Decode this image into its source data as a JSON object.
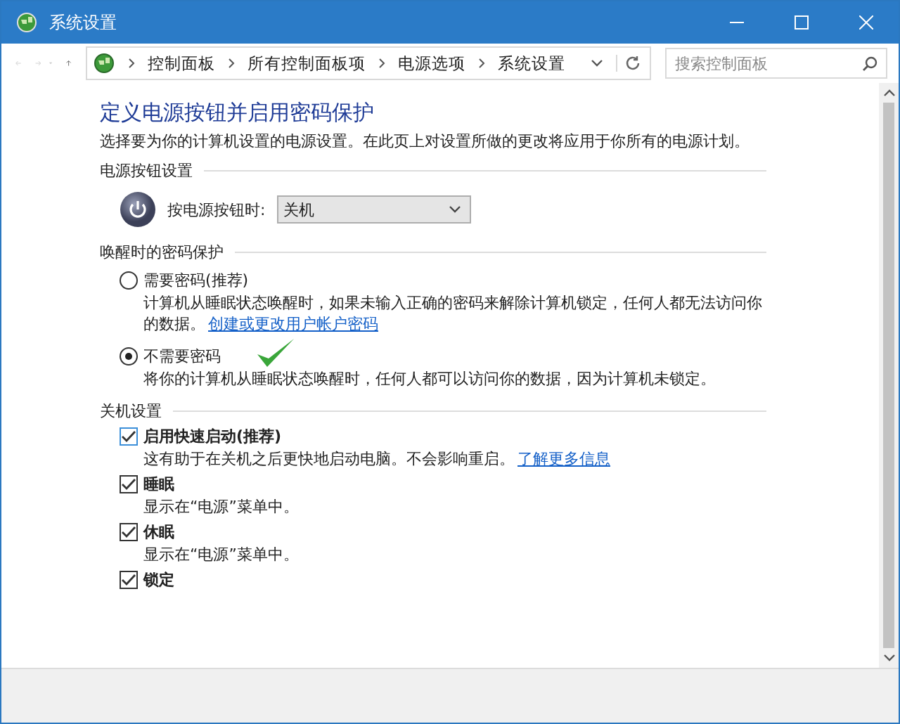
{
  "window": {
    "title": "系统设置"
  },
  "address_bar": {
    "breadcrumbs": [
      "控制面板",
      "所有控制面板项",
      "电源选项",
      "系统设置"
    ],
    "search": {
      "placeholder": "搜索控制面板"
    }
  },
  "page": {
    "heading": "定义电源按钮并启用密码保护",
    "description": "选择要为你的计算机设置的电源设置。在此页上对设置所做的更改将应用于你所有的电源计划。",
    "sections": [
      {
        "kind": "power",
        "title": "电源按钮设置",
        "label": "按电源按钮时:",
        "value": "关机"
      },
      {
        "kind": "radio",
        "title": "唤醒时的密码保护",
        "options": [
          {
            "label": "需要密码(推荐)",
            "selected": false,
            "description": "计算机从睡眠状态唤醒时，如果未输入正确的密码来解除计算机锁定，任何人都无法访问你的数据。",
            "link": "创建或更改用户帐户密码"
          },
          {
            "label": "不需要密码",
            "selected": true,
            "description": "将你的计算机从睡眠状态唤醒时，任何人都可以访问你的数据，因为计算机未锁定。"
          }
        ]
      },
      {
        "kind": "checkbox",
        "title": "关机设置",
        "options": [
          {
            "label": "启用快速启动(推荐)",
            "checked": true,
            "description": "这有助于在关机之后更快地启动电脑。不会影响重启。",
            "link": "了解更多信息"
          },
          {
            "label": "睡眠",
            "checked": true,
            "description": "显示在“电源”菜单中。"
          },
          {
            "label": "休眠",
            "checked": true,
            "description": "显示在“电源”菜单中。"
          },
          {
            "label": "锁定",
            "checked": true
          }
        ]
      }
    ]
  }
}
